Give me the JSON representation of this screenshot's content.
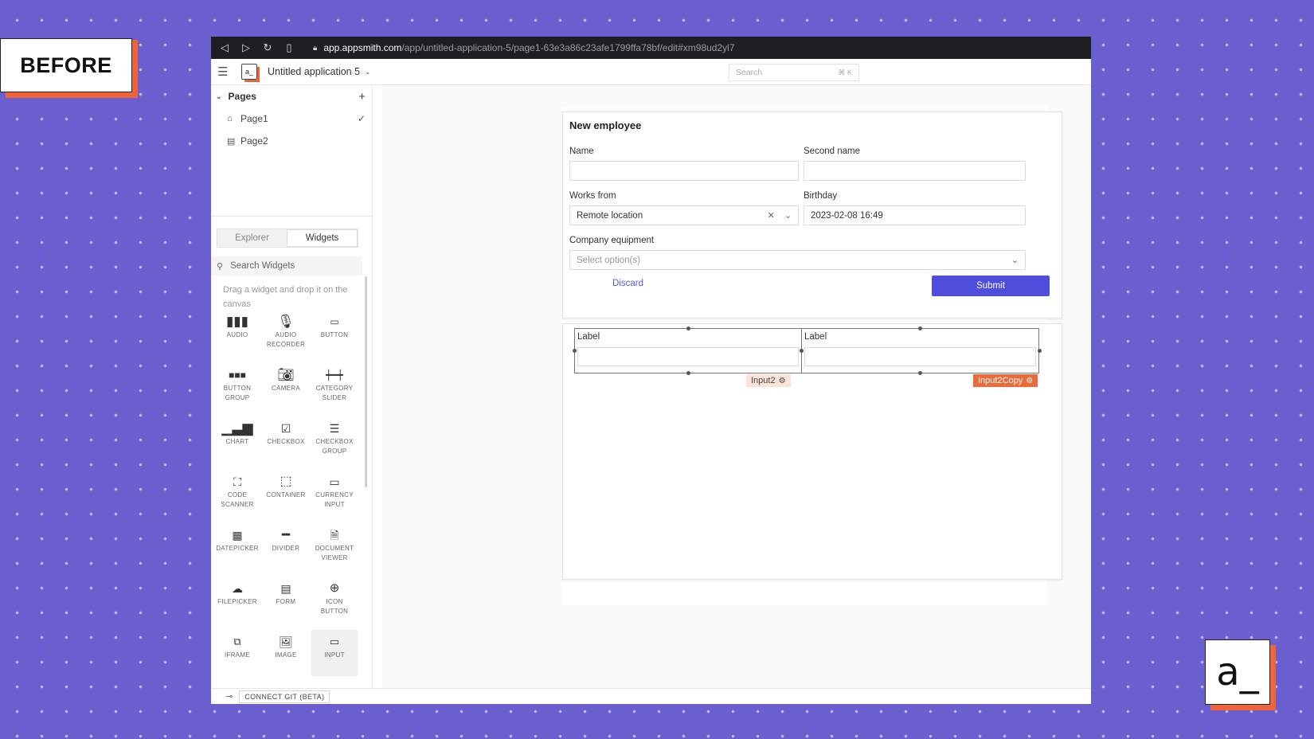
{
  "badge": {
    "label": "BEFORE"
  },
  "logo": {
    "text": "a_"
  },
  "browser": {
    "url_host": "app.appsmith.com",
    "url_path": "/app/untitled-application-5/page1-63e3a86c23afe1799ffa78bf/edit#xm98ud2yl7"
  },
  "appbar": {
    "icon_text": "a_",
    "title": "Untitled application 5",
    "search_placeholder": "Search",
    "search_shortcut": "⌘ K"
  },
  "sidebar": {
    "pages_title": "Pages",
    "pages": [
      {
        "label": "Page1",
        "icon": "home-icon",
        "selected": true
      },
      {
        "label": "Page2",
        "icon": "page-icon",
        "selected": false
      }
    ],
    "tabs": [
      "Explorer",
      "Widgets"
    ],
    "active_tab": "Widgets",
    "search_placeholder": "Search Widgets",
    "hint": "Drag a widget and drop it on the canvas",
    "widgets": [
      {
        "label": "AUDIO",
        "icon": "audio-icon"
      },
      {
        "label": "AUDIO RECORDER",
        "icon": "microphone-icon"
      },
      {
        "label": "BUTTON",
        "icon": "button-icon"
      },
      {
        "label": "BUTTON GROUP",
        "icon": "button-group-icon"
      },
      {
        "label": "CAMERA",
        "icon": "camera-icon"
      },
      {
        "label": "CATEGORY SLIDER",
        "icon": "category-slider-icon"
      },
      {
        "label": "CHART",
        "icon": "chart-icon"
      },
      {
        "label": "CHECKBOX",
        "icon": "checkbox-icon"
      },
      {
        "label": "CHECKBOX GROUP",
        "icon": "checkbox-group-icon"
      },
      {
        "label": "CODE SCANNER",
        "icon": "code-scanner-icon"
      },
      {
        "label": "CONTAINER",
        "icon": "container-icon"
      },
      {
        "label": "CURRENCY INPUT",
        "icon": "currency-input-icon"
      },
      {
        "label": "DATEPICKER",
        "icon": "calendar-icon"
      },
      {
        "label": "DIVIDER",
        "icon": "divider-icon"
      },
      {
        "label": "DOCUMENT VIEWER",
        "icon": "document-icon"
      },
      {
        "label": "FILEPICKER",
        "icon": "upload-icon"
      },
      {
        "label": "FORM",
        "icon": "form-icon"
      },
      {
        "label": "ICON BUTTON",
        "icon": "plus-circle-icon"
      },
      {
        "label": "IFRAME",
        "icon": "iframe-icon"
      },
      {
        "label": "IMAGE",
        "icon": "image-icon"
      },
      {
        "label": "INPUT",
        "icon": "input-icon"
      }
    ],
    "footer_button": "CONNECT GIT (BETA)"
  },
  "form": {
    "title": "New employee",
    "name_label": "Name",
    "name_value": "",
    "second_name_label": "Second name",
    "second_name_value": "",
    "works_from_label": "Works from",
    "works_from_value": "Remote location",
    "birthday_label": "Birthday",
    "birthday_value": "2023-02-08 16:49",
    "equipment_label": "Company equipment",
    "equipment_placeholder": "Select option(s)",
    "discard_label": "Discard",
    "submit_label": "Submit"
  },
  "canvas_widgets": [
    {
      "label": "Label",
      "tag": "Input2"
    },
    {
      "label": "Label",
      "tag": "Input2Copy"
    }
  ],
  "colors": {
    "background": "#6b5fcf",
    "accent": "#f0643c",
    "primary_button": "#4f4ddc",
    "link": "#5b5bd6"
  }
}
